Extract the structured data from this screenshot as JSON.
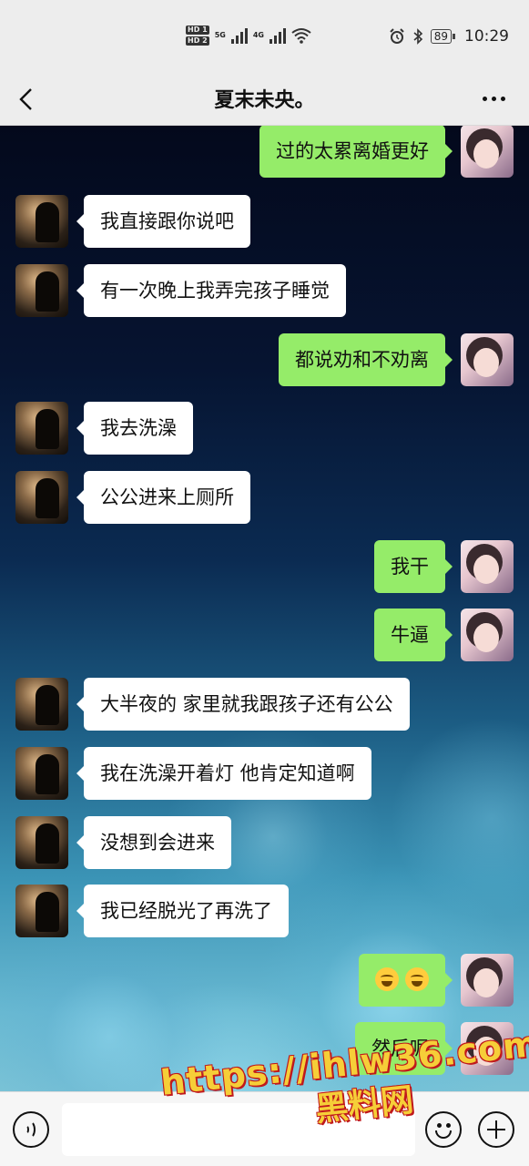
{
  "status_bar": {
    "hd1": "HD 1",
    "hd2": "HD 2",
    "net1": "5G",
    "net2": "4G",
    "battery": "89",
    "time": "10:29",
    "icons": [
      "alarm-icon",
      "bluetooth-icon",
      "wifi-icon",
      "signal-icon"
    ]
  },
  "header": {
    "title": "夏末未央。",
    "back_icon": "chevron-left-icon",
    "more_icon": "more-dots-icon"
  },
  "messages": [
    {
      "side": "right",
      "text": "过的太累离婚更好"
    },
    {
      "side": "left",
      "text": "我直接跟你说吧"
    },
    {
      "side": "left",
      "text": "有一次晚上我弄完孩子睡觉"
    },
    {
      "side": "right",
      "text": "都说劝和不劝离"
    },
    {
      "side": "left",
      "text": "我去洗澡"
    },
    {
      "side": "left",
      "text": "公公进来上厕所"
    },
    {
      "side": "right",
      "text": "我干"
    },
    {
      "side": "right",
      "text": "牛逼"
    },
    {
      "side": "left",
      "text": "大半夜的 家里就我跟孩子还有公公"
    },
    {
      "side": "left",
      "text": "我在洗澡开着灯 他肯定知道啊"
    },
    {
      "side": "left",
      "text": "没想到会进来"
    },
    {
      "side": "left",
      "text": "我已经脱光了再洗了"
    },
    {
      "side": "right",
      "text": "",
      "emoji": "laughing-crying-emoji x2"
    },
    {
      "side": "right",
      "text": "然后呢"
    }
  ],
  "input_bar": {
    "voice_icon": "voice-icon",
    "emoji_icon": "emoji-icon",
    "plus_icon": "plus-icon"
  },
  "watermark": {
    "url": "https://ihlw36.com",
    "name": "黑料网"
  },
  "colors": {
    "bubble_self": "#95ec69",
    "bubble_other": "#ffffff",
    "bar_bg": "#ededed"
  }
}
